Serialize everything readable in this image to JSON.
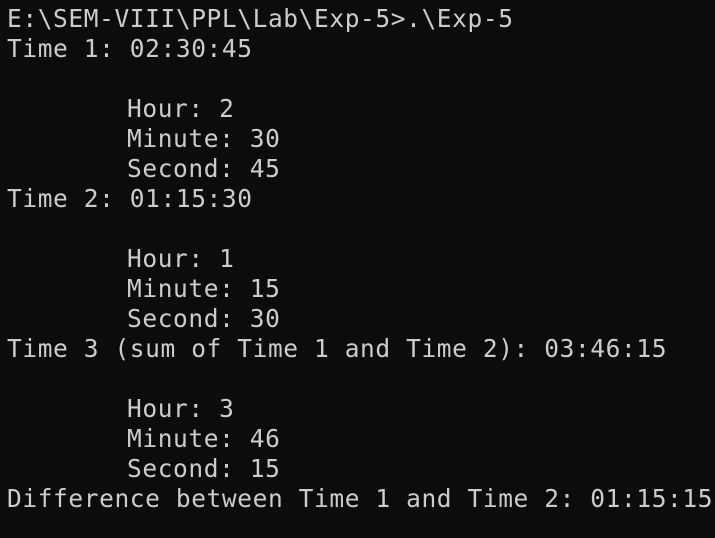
{
  "terminal": {
    "prompt": "E:\\SEM-VIII\\PPL\\Lab\\Exp-5>.\\Exp-5",
    "time1": {
      "header": "Time 1: 02:30:45",
      "hour": "Hour: 2",
      "minute": "Minute: 30",
      "second": "Second: 45"
    },
    "time2": {
      "header": "Time 2: 01:15:30",
      "hour": "Hour: 1",
      "minute": "Minute: 15",
      "second": "Second: 30"
    },
    "time3": {
      "header": "Time 3 (sum of Time 1 and Time 2): 03:46:15",
      "hour": "Hour: 3",
      "minute": "Minute: 46",
      "second": "Second: 15"
    },
    "difference": "Difference between Time 1 and Time 2: 01:15:15"
  },
  "colors": {
    "background": "#0c0c0c",
    "text": "#cccccc"
  }
}
